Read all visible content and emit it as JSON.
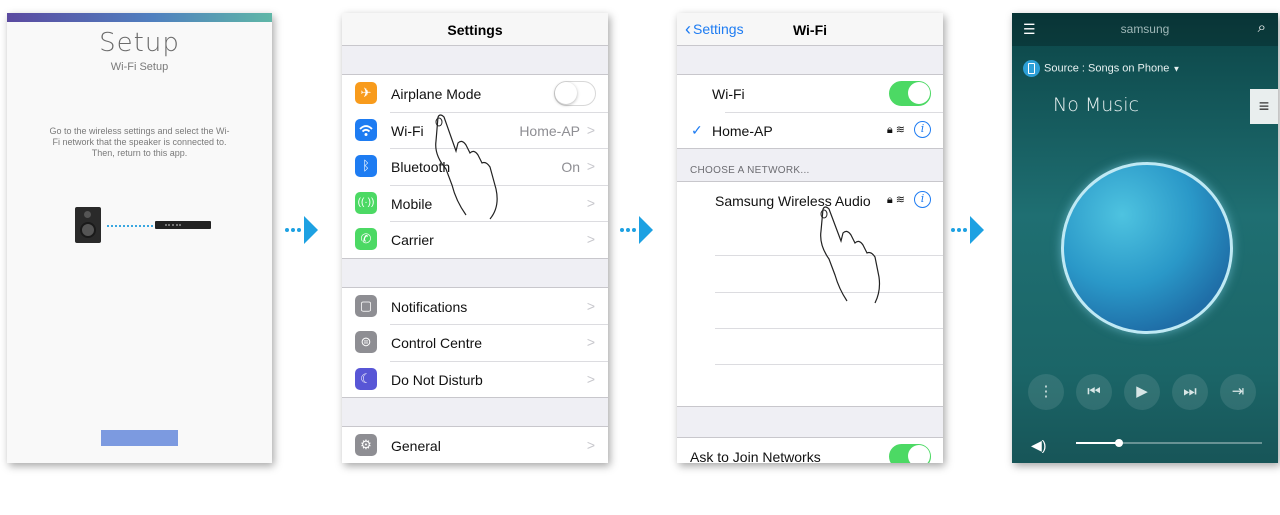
{
  "setup": {
    "title": "Setup",
    "subtitle": "Wi-Fi Setup",
    "instructions": "Go to the wireless settings and select the Wi-Fi network that the speaker is connected to. Then, return to this app."
  },
  "settings": {
    "title": "Settings",
    "group1": [
      {
        "label": "Airplane Mode",
        "value": "",
        "icon": "airplane-icon",
        "color": "#f89b1c"
      },
      {
        "label": "Wi-Fi",
        "value": "Home-AP",
        "icon": "wifi-icon",
        "color": "#1e7cf2"
      },
      {
        "label": "Bluetooth",
        "value": "On",
        "icon": "bluetooth-icon",
        "color": "#1e7cf2"
      },
      {
        "label": "Mobile",
        "value": "",
        "icon": "mobile-antenna-icon",
        "color": "#4cd964"
      },
      {
        "label": "Carrier",
        "value": "",
        "icon": "phone-icon",
        "color": "#4cd964"
      }
    ],
    "group2": [
      {
        "label": "Notifications",
        "icon": "notifications-icon",
        "color": "#8e8e93"
      },
      {
        "label": "Control Centre",
        "icon": "control-centre-icon",
        "color": "#8e8e93"
      },
      {
        "label": "Do Not Disturb",
        "icon": "moon-icon",
        "color": "#5856d6"
      }
    ],
    "group3": [
      {
        "label": "General",
        "icon": "gear-icon",
        "color": "#8e8e93"
      }
    ]
  },
  "wifi": {
    "back": "Settings",
    "title": "Wi-Fi",
    "wifi_label": "Wi-Fi",
    "wifi_on": true,
    "connected": "Home-AP",
    "section_header": "CHOOSE A NETWORK...",
    "networks": [
      "Samsung Wireless Audio"
    ],
    "ask_to_join": "Ask to Join Networks",
    "ask_to_join_on": true
  },
  "music": {
    "brand": "samsung",
    "source": "Source : Songs on Phone",
    "track": "No Music",
    "volume_level": 0.23
  },
  "colors": {
    "accent": "#1da1e2",
    "ios_blue": "#1e7cf2",
    "ios_green": "#4cd964"
  }
}
